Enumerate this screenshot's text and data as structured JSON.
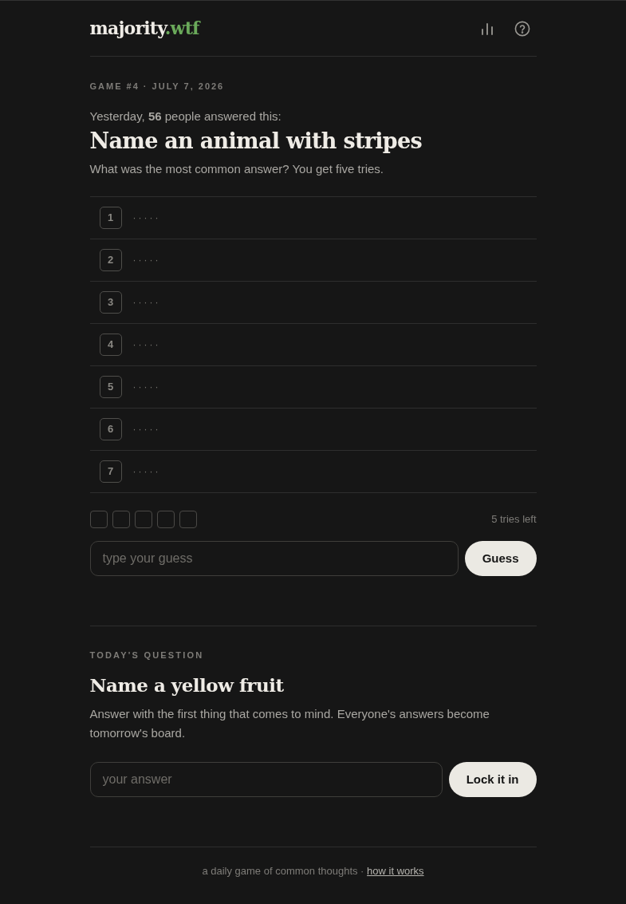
{
  "header": {
    "logo_main": "majority",
    "logo_accent": ".wtf"
  },
  "game": {
    "meta": "GAME #4 · JULY 7, 2026",
    "intro": "Yesterday, **56** people answered this:",
    "title": "Name an animal with stripes",
    "subtitle": "What was the most common answer? You get five tries."
  },
  "board": [
    {
      "number": "1",
      "answer": "·····"
    },
    {
      "number": "2",
      "answer": "·····"
    },
    {
      "number": "3",
      "answer": "·····"
    },
    {
      "number": "4",
      "answer": "·····"
    },
    {
      "number": "5",
      "answer": "·····"
    },
    {
      "number": "6",
      "answer": "·····"
    },
    {
      "number": "7",
      "answer": "·····"
    }
  ],
  "tries": [
    {
      "used": false
    },
    {
      "used": false
    },
    {
      "used": false
    },
    {
      "used": false
    },
    {
      "used": false
    }
  ],
  "tries_left": "5 tries left",
  "guess": {
    "placeholder": "type your guess",
    "button": "Guess"
  },
  "today": {
    "label": "TODAY'S QUESTION",
    "title": "Name a yellow fruit",
    "text": "Answer with the first thing that comes to mind. Everyone's answers become tomorrow's board.",
    "placeholder": "your answer",
    "button": "Lock it in"
  },
  "footer": {
    "text": "a daily game of common thoughts ·",
    "link": "how it works"
  }
}
